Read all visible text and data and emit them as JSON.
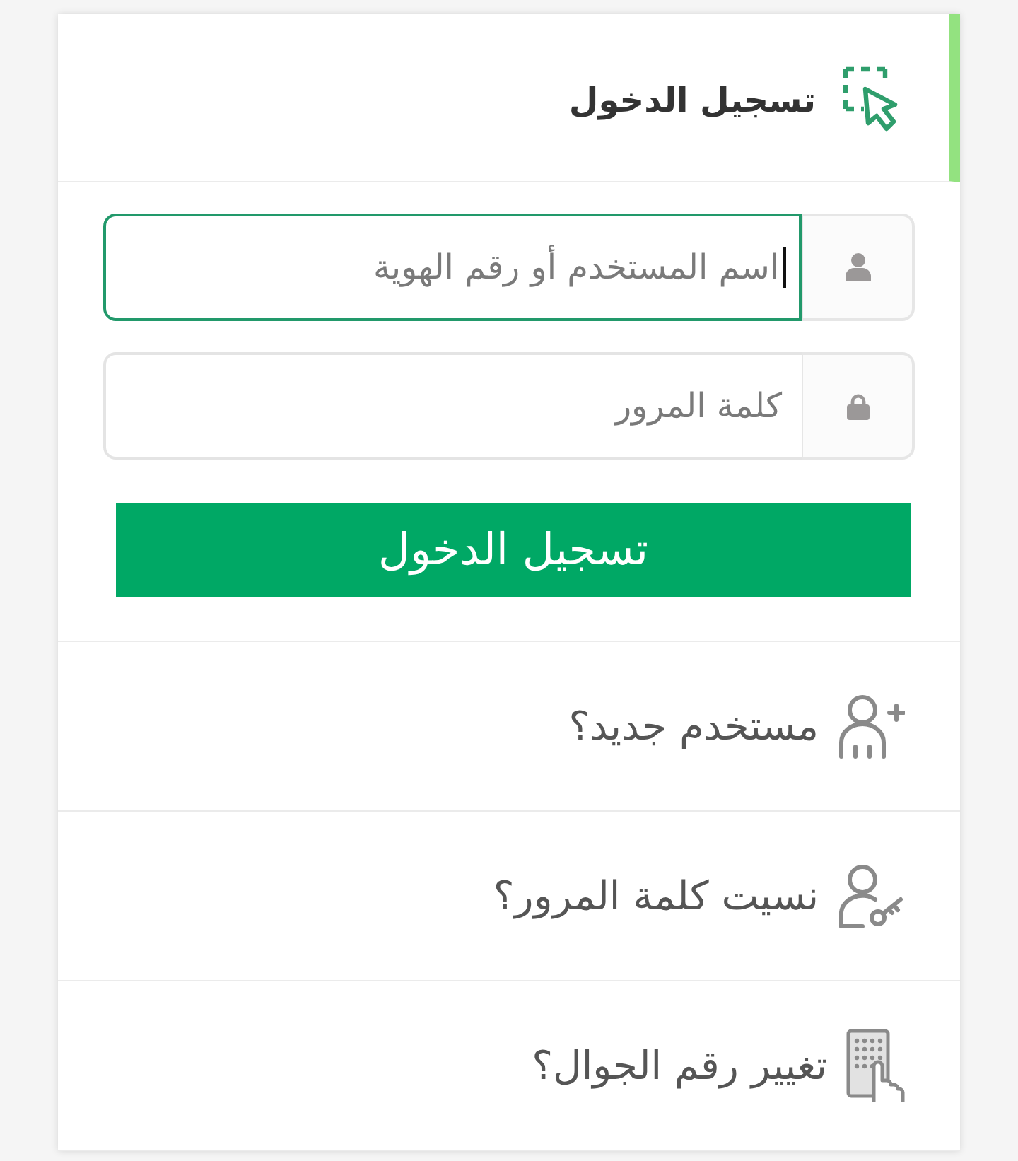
{
  "header": {
    "title": "تسجيل الدخول"
  },
  "form": {
    "fields": [
      {
        "kind": "user",
        "placeholder": "اسم المستخدم أو رقم الهوية",
        "focused": true
      },
      {
        "kind": "password",
        "placeholder": "كلمة المرور",
        "focused": false
      }
    ],
    "submit": "تسجيل الدخول"
  },
  "links": [
    {
      "kind": "register",
      "label": "مستخدم جديد؟"
    },
    {
      "kind": "forgot",
      "label": "نسيت كلمة المرور؟"
    },
    {
      "kind": "mobile",
      "label": "تغيير رقم الجوال؟"
    }
  ]
}
